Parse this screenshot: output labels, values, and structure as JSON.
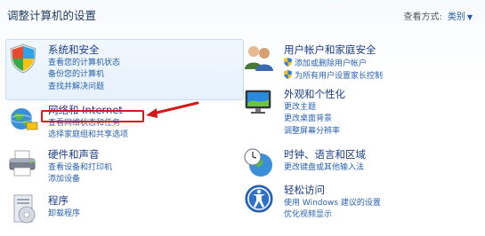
{
  "header": {
    "title": "调整计算机的设置",
    "view_by_label": "查看方式:",
    "view_by_value": "类别"
  },
  "categories": [
    {
      "id": "system-security",
      "title": "系统和安全",
      "icon": "shield-icon",
      "links": [
        "查看您的计算机状态",
        "备份您的计算机",
        "查找并解决问题"
      ]
    },
    {
      "id": "network-internet",
      "title": "网络和 Internet",
      "icon": "network-globe-icon",
      "links": [
        "查看网络状态和任务",
        "选择家庭组和共享选项"
      ]
    },
    {
      "id": "hardware-sound",
      "title": "硬件和声音",
      "icon": "printer-icon",
      "links": [
        "查看设备和打印机",
        "添加设备"
      ]
    },
    {
      "id": "programs",
      "title": "程序",
      "icon": "programs-icon",
      "links": [
        "卸载程序"
      ]
    },
    {
      "id": "user-accounts",
      "title": "用户帐户和家庭安全",
      "icon": "users-icon",
      "links": [
        "添加或删除用户帐户",
        "为所有用户设置家长控制"
      ]
    },
    {
      "id": "appearance",
      "title": "外观和个性化",
      "icon": "monitor-icon",
      "links": [
        "更改主题",
        "更改桌面背景",
        "调整屏幕分辨率"
      ]
    },
    {
      "id": "clock-region",
      "title": "时钟、语言和区域",
      "icon": "clock-globe-icon",
      "links": [
        "更改键盘或其他输入法"
      ]
    },
    {
      "id": "ease-of-access",
      "title": "轻松访问",
      "icon": "ease-of-access-icon",
      "links": [
        "使用 Windows 建议的设置",
        "优化视频显示"
      ]
    }
  ],
  "colors": {
    "link": "#2a62b0",
    "title": "#1a3d82",
    "annotation": "#d21a1a"
  }
}
